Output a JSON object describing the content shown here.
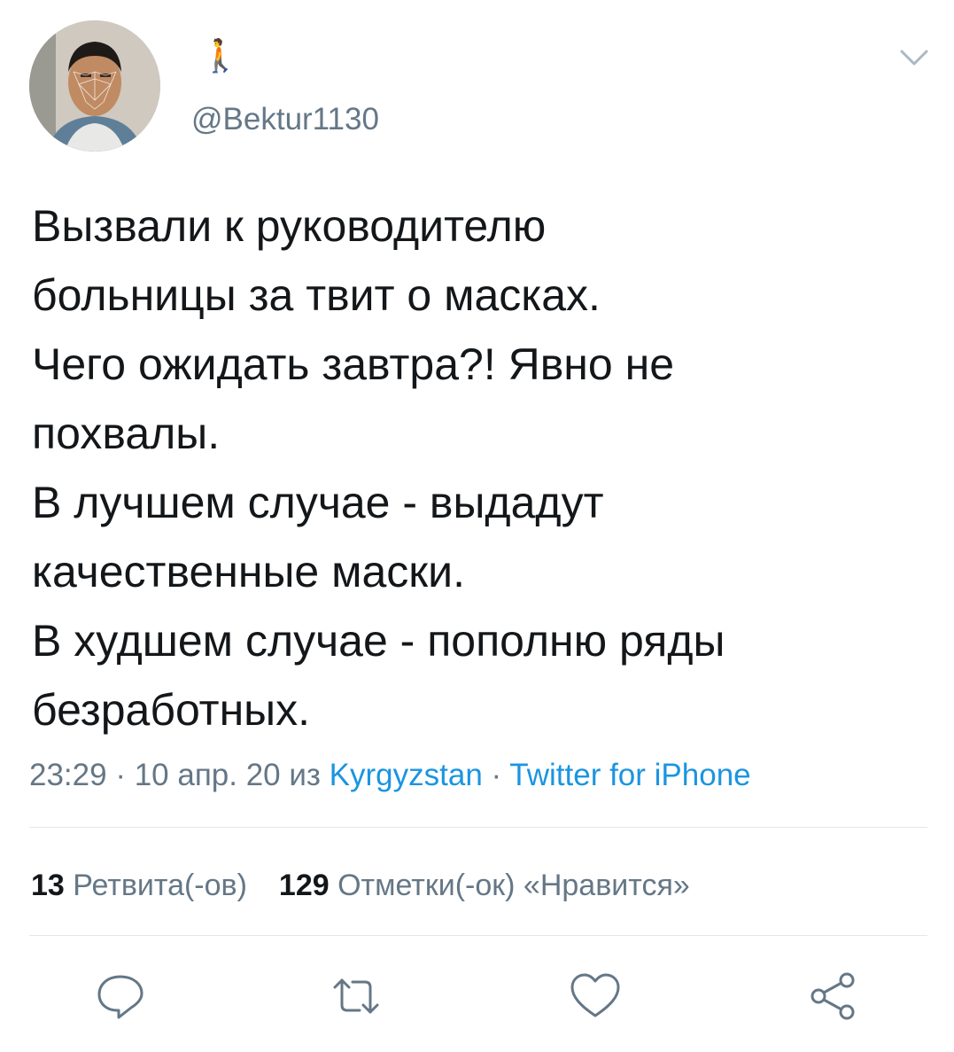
{
  "header": {
    "display_name": "🚶",
    "handle": "@Bektur1130"
  },
  "tweet": {
    "lines": [
      "Вызвали к руководителю",
      "больницы за твит о масках.",
      "Чего ожидать завтра?! Явно не",
      "похвалы.",
      "В лучшем случае - выдадут",
      "качественные маски.",
      "В худшем случае - пополню ряды",
      "безработных."
    ]
  },
  "meta": {
    "time": "23:29",
    "sep1": " · ",
    "date": "10 апр. 20",
    "from_label": " из ",
    "location": "Kyrgyzstan",
    "sep2": " · ",
    "source": "Twitter for iPhone"
  },
  "stats": {
    "retweets_count": "13",
    "retweets_label": "Ретвита(-ов)",
    "likes_count": "129",
    "likes_label": "Отметки(-ок) «Нравится»"
  },
  "colors": {
    "text": "#14171a",
    "secondary": "#657786",
    "link": "#1b95e0",
    "divider": "#e1e8ed"
  },
  "icons": {
    "more": "chevron-down-icon",
    "reply": "reply-icon",
    "retweet": "retweet-icon",
    "like": "heart-icon",
    "share": "share-icon"
  }
}
